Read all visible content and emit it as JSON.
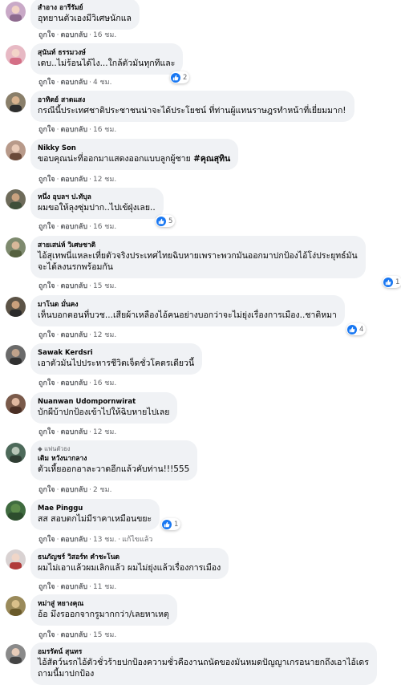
{
  "labels": {
    "like": "ถูกใจ",
    "reply": "ตอบกลับ",
    "sep": "·"
  },
  "colors": {
    "like_blue": "#1877f2",
    "bubble_bg": "#f0f2f5",
    "meta_gray": "#65676b"
  },
  "comments": [
    {
      "name": "สำอาง อารีรัมย์",
      "text": "อุทยานตัวเองมีวิเศษนักแล",
      "time": "16 ชม."
    },
    {
      "name": "สุนันท์ ธรรมวงษ์",
      "text": "เดบ..ไม่ร้อนได้ไง...ใกล้ตัวมันทุกทีและ",
      "time": "4 ชม.",
      "reactions": "2"
    },
    {
      "name": "อาทิตย์ สาดแสง",
      "text": "กรณีนี้ประเทศชาติประชาชนน่าจะได้ประโยชน์ ที่ท่านผู้แทนราษฎรทำหน้าที่เยี่ยมมาก!",
      "time": "16 ชม."
    },
    {
      "name": "Nikky Son",
      "text": "ขอบคุณน่ะที่ออกมาแสดงออกแบบลูกผู้ชาย ",
      "hashtag": "#คุณสุทิน",
      "time": "12 ชม."
    },
    {
      "name": "หนึ่ง อุบลฯ ป.ทับุล",
      "text": "ผมขอให้ลุงซุ่มปาก..ไปเข้ฝุ่งเลย..",
      "time": "16 ชม.",
      "reactions": "5"
    },
    {
      "name": "สายเสน่ห์ วิเศษชาติ",
      "text": "ไอ้สุเทพนี่แหละเที่ยตัวจริงประเทศไทยฉิบหายเพราะพวกมันออกมาปกป้องไอ้โง่ประยุทธ์มัน",
      "text2": "จะได้ลงนรกพร้อมกัน",
      "time": "15 ชม.",
      "reactions": "1"
    },
    {
      "name": "มาโนด มั่นคง",
      "text": "เห็นบอกตอนที่บวช...เสียผ้าเหลืองไอ้คนอย่างบอกว่าจะไม่ยุ่งเรื่องการเมือง..ชาติหมา",
      "time": "12 ชม.",
      "reactions": "4"
    },
    {
      "name": "Sawak Kerdsri",
      "text": "เอาตัวมันไปประหารชีวิตเจ็ดชั่วโคตรเดียวนี้",
      "time": "16 ชม."
    },
    {
      "name": "Nuanwan Udompornwirat",
      "text": "บักผีบ้าปกป้องเข้าไปให้ฉิบหายไปเลย",
      "time": "12 ชม."
    },
    {
      "badge": "แฟนตัวยง",
      "name": "เติม หวังนากลาง",
      "text": "ตัวเหี้ยออกอาละวาดอีกแล้วคับท่าน!!!555",
      "time": "2 ชม."
    },
    {
      "name": "Mae Pinggu",
      "text": "สส สอบตกไม่มีราคาเหมือนขยะ",
      "time": "13 ชม.",
      "edited": "แก้ไขแล้ว",
      "reactions": "1"
    },
    {
      "name": "ธนภัญชร์ วิสอร์ท คำชะโนด",
      "text": "ผมไม่เอาแล้วผมเลิกแล้ว ผมไม่ยุ่งแล้วเรื่องการเมือง",
      "time": "11 ชม."
    },
    {
      "name": "หม่าสู่ หยางคุณ",
      "text": "อ้อ มึงรออกจากรูมากกว่า/เลยหาเหตุ",
      "time": "15 ชม."
    },
    {
      "name": "อมรรัตน์ สุนทร",
      "text": "ไอ้สัตว์นรกไอ้ตัวชั่วร้ายปกป้องความชั่วคืองานถนัดของมันหมดปัญญาเกรอนายกถึงเอาไอ้เดร",
      "text2": "ถามนี้มาปกป้อง"
    }
  ]
}
